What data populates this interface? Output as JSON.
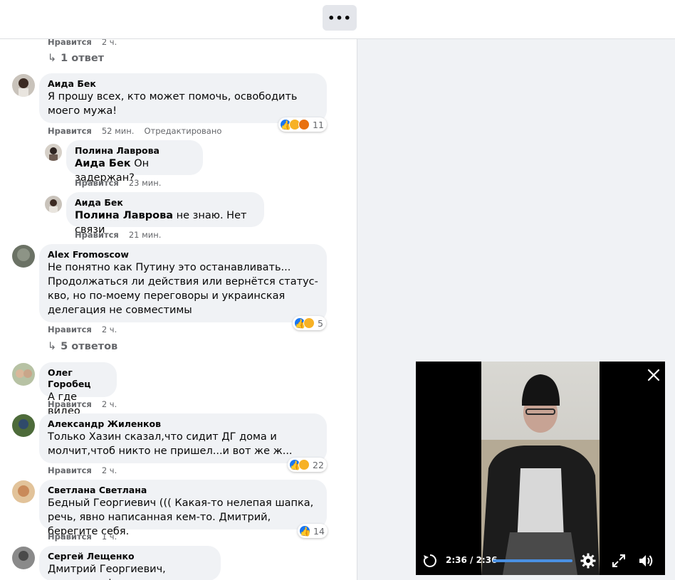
{
  "topbar": {
    "more_label": "•••"
  },
  "comments": [
    {
      "id": "c0",
      "meta": {
        "like": "Нравится",
        "time": "2 ч."
      },
      "replies_label": "1 ответ"
    },
    {
      "id": "c1",
      "author": "Аида Бек",
      "text": "Я прошу всех, кто может помочь, освободить моего мужа!",
      "meta": {
        "like": "Нравится",
        "time": "52 мин.",
        "edited": "Отредактировано"
      },
      "reactions": {
        "count": "11",
        "types": [
          "like",
          "wow",
          "angry"
        ]
      }
    },
    {
      "id": "r1",
      "author": "Полина Лаврова",
      "mention": "Аида Бек",
      "text": "Он задержан?",
      "meta": {
        "like": "Нравится",
        "time": "23 мин."
      }
    },
    {
      "id": "r2",
      "author": "Аида Бек",
      "mention": "Полина Лаврова",
      "text": "не знаю. Нет связи",
      "meta": {
        "like": "Нравится",
        "time": "21 мин."
      }
    },
    {
      "id": "c2",
      "author": "Alex Fromoscow",
      "text": "Не понятно как Путину это останавливать... Продолжаться ли действия или вернётся статус-кво, но по-моему переговоры и украинская делегация не совместимы",
      "meta": {
        "like": "Нравится",
        "time": "2 ч."
      },
      "reactions": {
        "count": "5",
        "types": [
          "like",
          "wow"
        ]
      },
      "replies_label": "5 ответов"
    },
    {
      "id": "c3",
      "author": "Олег Горобец",
      "text": "А где видео",
      "meta": {
        "like": "Нравится",
        "time": "2 ч."
      }
    },
    {
      "id": "c4",
      "author": "Александр Жиленков",
      "text": "Только Хазин сказал,что сидит ДГ дома и молчит,чтоб никто не пришел...и вот же ж...",
      "meta": {
        "like": "Нравится",
        "time": "2 ч."
      },
      "reactions": {
        "count": "22",
        "types": [
          "like",
          "sad"
        ]
      }
    },
    {
      "id": "c5",
      "author": "Светлана Светлана",
      "text": "Бедный Георгиевич ((( Какая-то нелепая шапка, речь, явно написанная кем-то. Дмитрий, берегите себя.",
      "meta": {
        "like": "Нравится",
        "time": "1 ч."
      },
      "reactions": {
        "count": "14",
        "types": [
          "like"
        ]
      }
    },
    {
      "id": "c6",
      "author": "Сергей Лещенко",
      "text": "Дмитрий Георгиевич, держитесь!"
    }
  ],
  "video": {
    "time_label": "2:36 / 2:36",
    "progress": 1.0,
    "icons": [
      "replay-icon",
      "settings-icon",
      "fullscreen-icon",
      "volume-icon",
      "close-icon"
    ]
  },
  "colors": {
    "accent": "#1877f2",
    "bubble": "#f0f2f5",
    "meta": "#65676b",
    "progress": "#4a90e2"
  }
}
